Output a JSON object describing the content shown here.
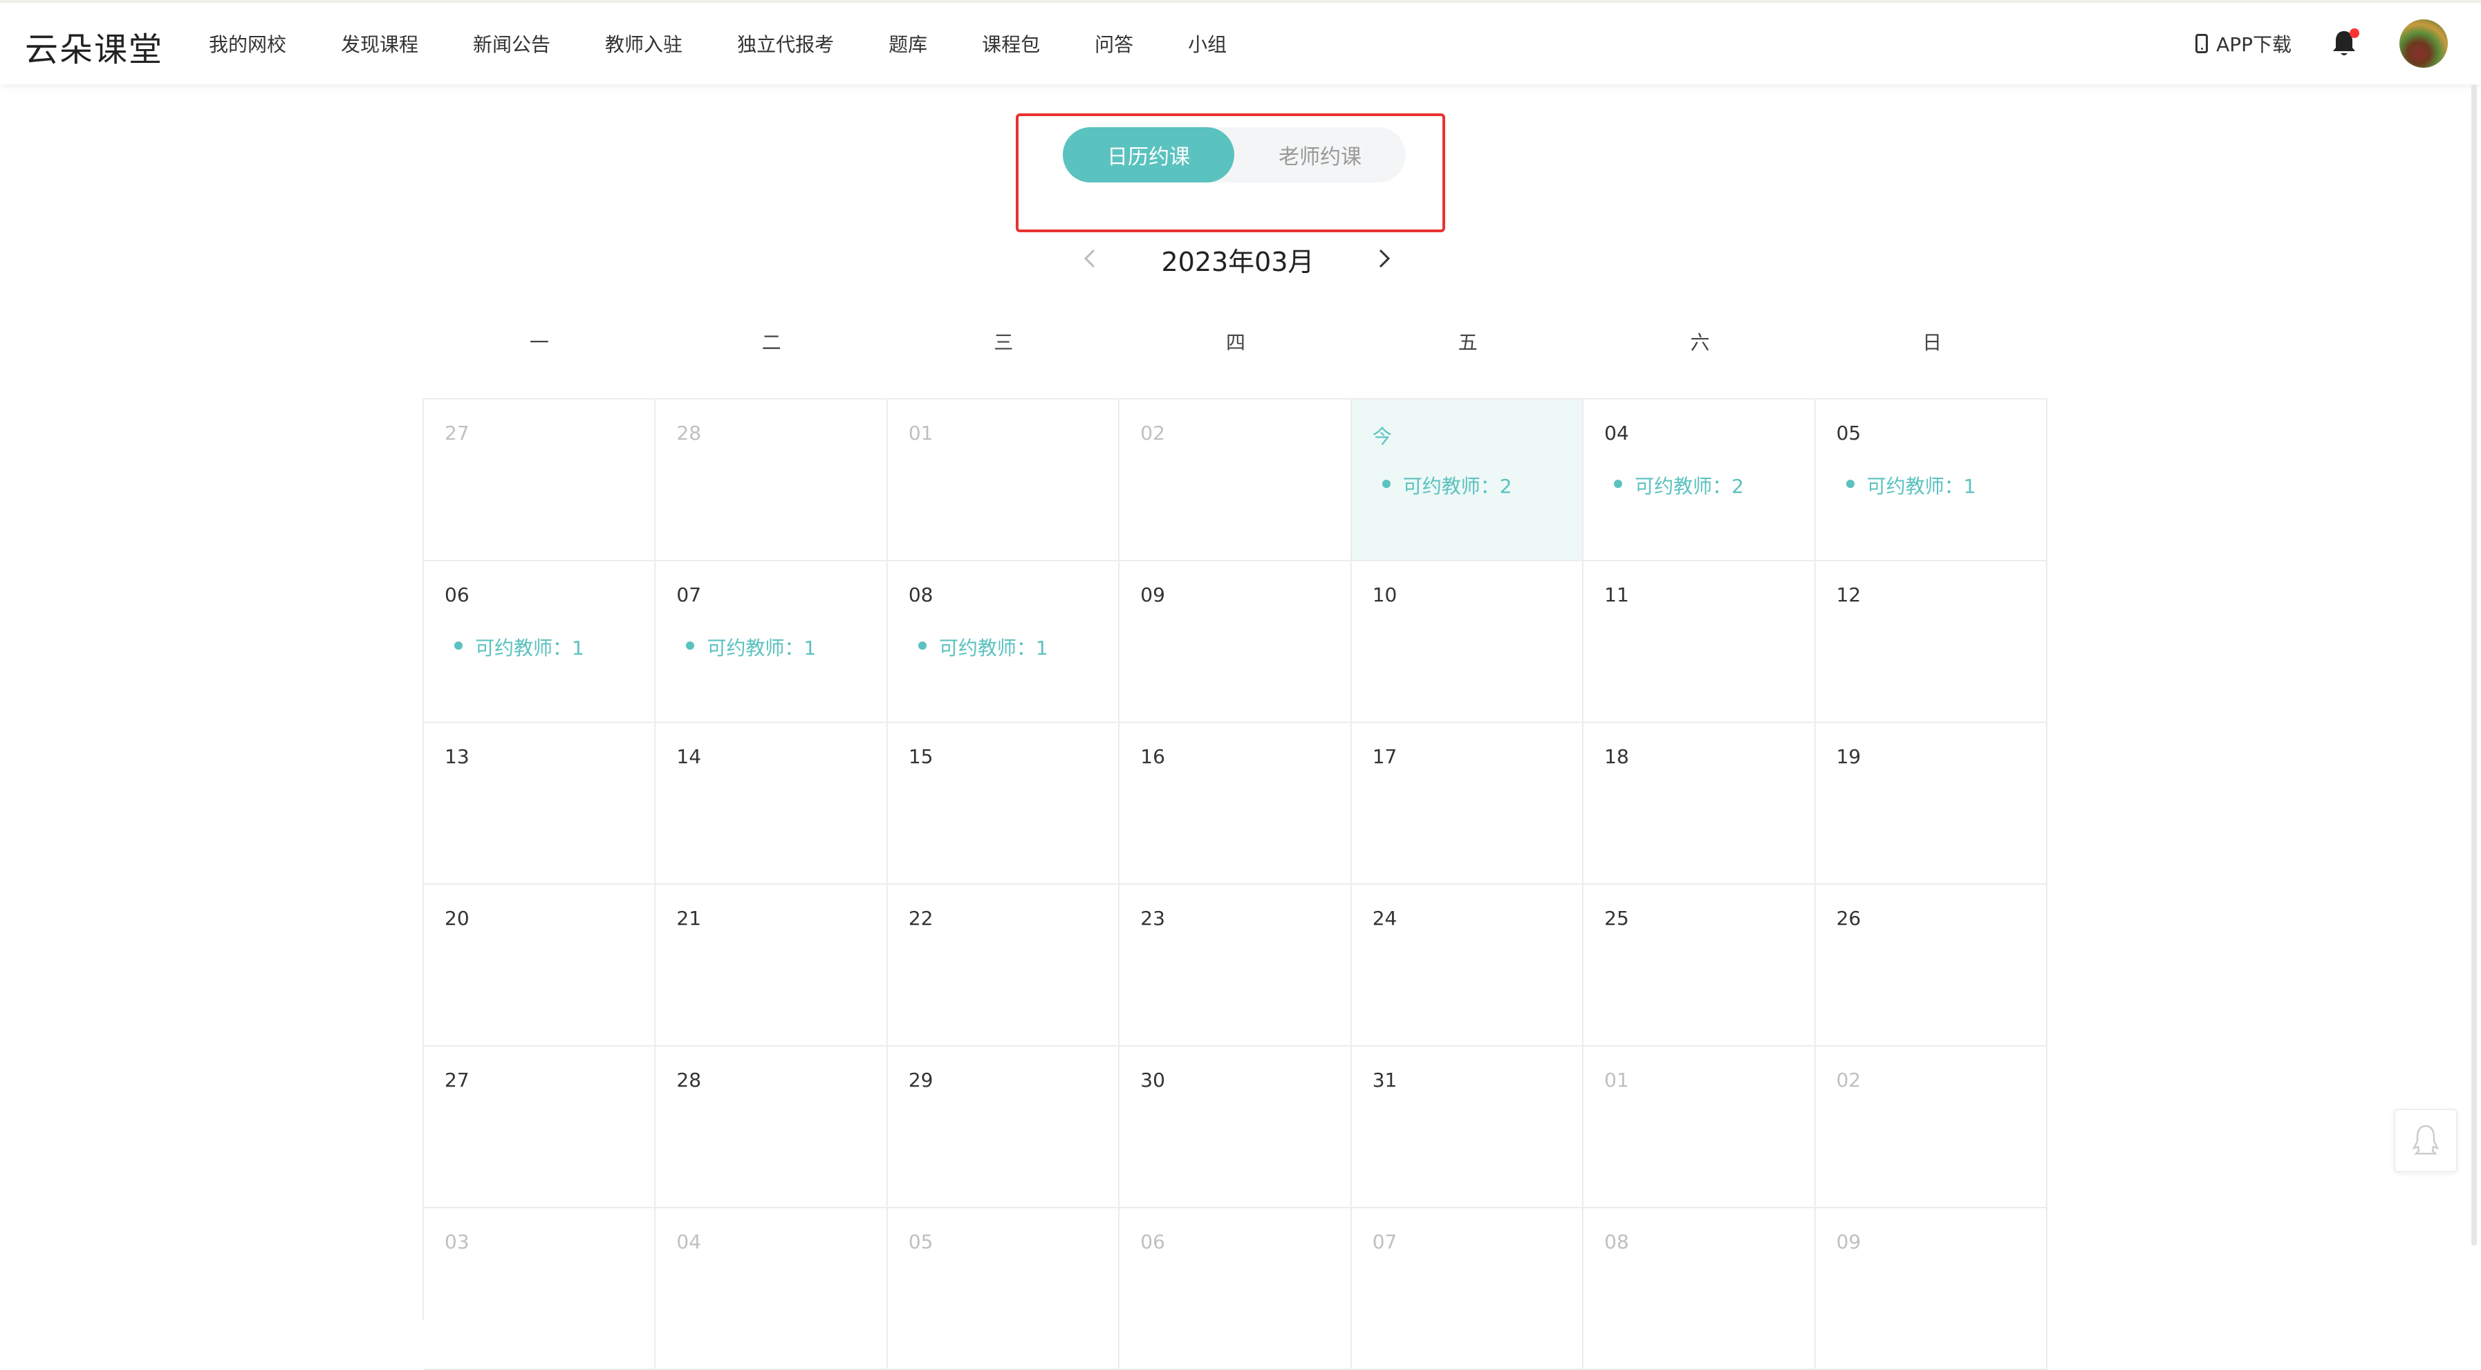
{
  "header": {
    "logo": "云朵课堂",
    "nav": [
      "我的网校",
      "发现课程",
      "新闻公告",
      "教师入驻",
      "独立代报考",
      "题库",
      "课程包",
      "问答",
      "小组"
    ],
    "app_download": "APP下载",
    "icons": {
      "phone": "phone-icon",
      "bell": "bell-icon",
      "avatar": "avatar"
    }
  },
  "toggle": {
    "active": "日历约课",
    "inactive": "老师约课"
  },
  "month_label": "2023年03月",
  "weekdays": [
    "一",
    "二",
    "三",
    "四",
    "五",
    "六",
    "日"
  ],
  "calendar": [
    {
      "day": "27",
      "other": true
    },
    {
      "day": "28",
      "other": true
    },
    {
      "day": "01",
      "other": true
    },
    {
      "day": "02",
      "other": true
    },
    {
      "day": "今",
      "today": true,
      "avail": "可约教师：2"
    },
    {
      "day": "04",
      "avail": "可约教师：2"
    },
    {
      "day": "05",
      "avail": "可约教师：1"
    },
    {
      "day": "06",
      "avail": "可约教师：1"
    },
    {
      "day": "07",
      "avail": "可约教师：1"
    },
    {
      "day": "08",
      "avail": "可约教师：1"
    },
    {
      "day": "09"
    },
    {
      "day": "10"
    },
    {
      "day": "11"
    },
    {
      "day": "12"
    },
    {
      "day": "13"
    },
    {
      "day": "14"
    },
    {
      "day": "15"
    },
    {
      "day": "16"
    },
    {
      "day": "17"
    },
    {
      "day": "18"
    },
    {
      "day": "19"
    },
    {
      "day": "20"
    },
    {
      "day": "21"
    },
    {
      "day": "22"
    },
    {
      "day": "23"
    },
    {
      "day": "24"
    },
    {
      "day": "25"
    },
    {
      "day": "26"
    },
    {
      "day": "27"
    },
    {
      "day": "28"
    },
    {
      "day": "29"
    },
    {
      "day": "30"
    },
    {
      "day": "31"
    },
    {
      "day": "01",
      "other": true
    },
    {
      "day": "02",
      "other": true
    },
    {
      "day": "03",
      "other": true
    },
    {
      "day": "04",
      "other": true
    },
    {
      "day": "05",
      "other": true
    },
    {
      "day": "06",
      "other": true
    },
    {
      "day": "07",
      "other": true
    },
    {
      "day": "08",
      "other": true
    },
    {
      "day": "09",
      "other": true
    }
  ],
  "colors": {
    "accent": "#5ac2bf",
    "today_bg": "#edf8f7",
    "highlight_frame": "#e8332f",
    "notification_dot": "#ff3333"
  },
  "float_button_icon": "qq-icon"
}
